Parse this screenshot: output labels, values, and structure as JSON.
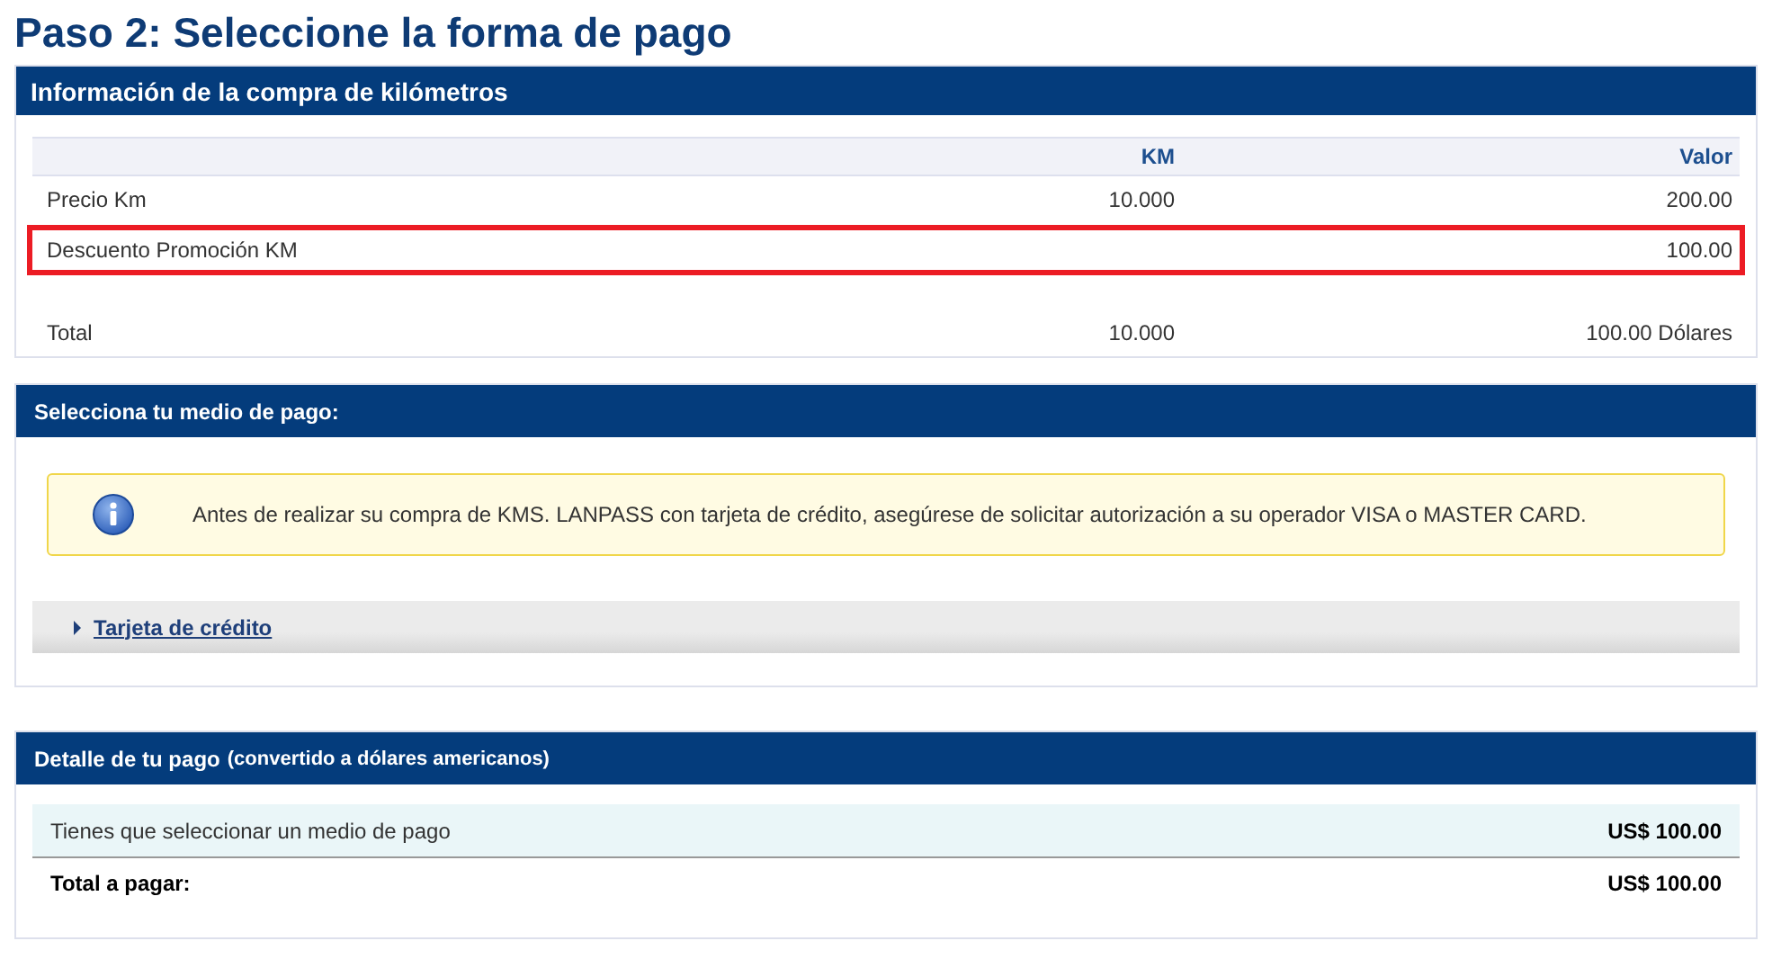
{
  "page_title": "Paso 2: Seleccione la forma de pago",
  "purchase": {
    "header": "Información de la compra de kilómetros",
    "columns": [
      "",
      "KM",
      "Valor"
    ],
    "rows": [
      {
        "label": "Precio Km",
        "km": "10.000",
        "value": "200.00",
        "highlighted": false
      },
      {
        "label": "Descuento Promoción KM",
        "km": "",
        "value": "100.00",
        "highlighted": true
      }
    ],
    "total": {
      "label": "Total",
      "km": "10.000",
      "value": "100.00 Dólares"
    }
  },
  "payment_method": {
    "header": "Selecciona tu medio de pago:",
    "notice": "Antes de realizar su compra de KMS. LANPASS con tarjeta de crédito, asegúrese de solicitar autorización a su operador VISA o MASTER CARD.",
    "options": [
      {
        "label": "Tarjeta de crédito",
        "expanded": false
      }
    ]
  },
  "payment_detail": {
    "header": "Detalle de tu pago",
    "header_note": "(convertido a dólares americanos)",
    "row": {
      "label": "Tienes que seleccionar un medio de pago",
      "value": "US$ 100.00"
    },
    "total": {
      "label": "Total a pagar:",
      "value": "US$ 100.00"
    }
  }
}
